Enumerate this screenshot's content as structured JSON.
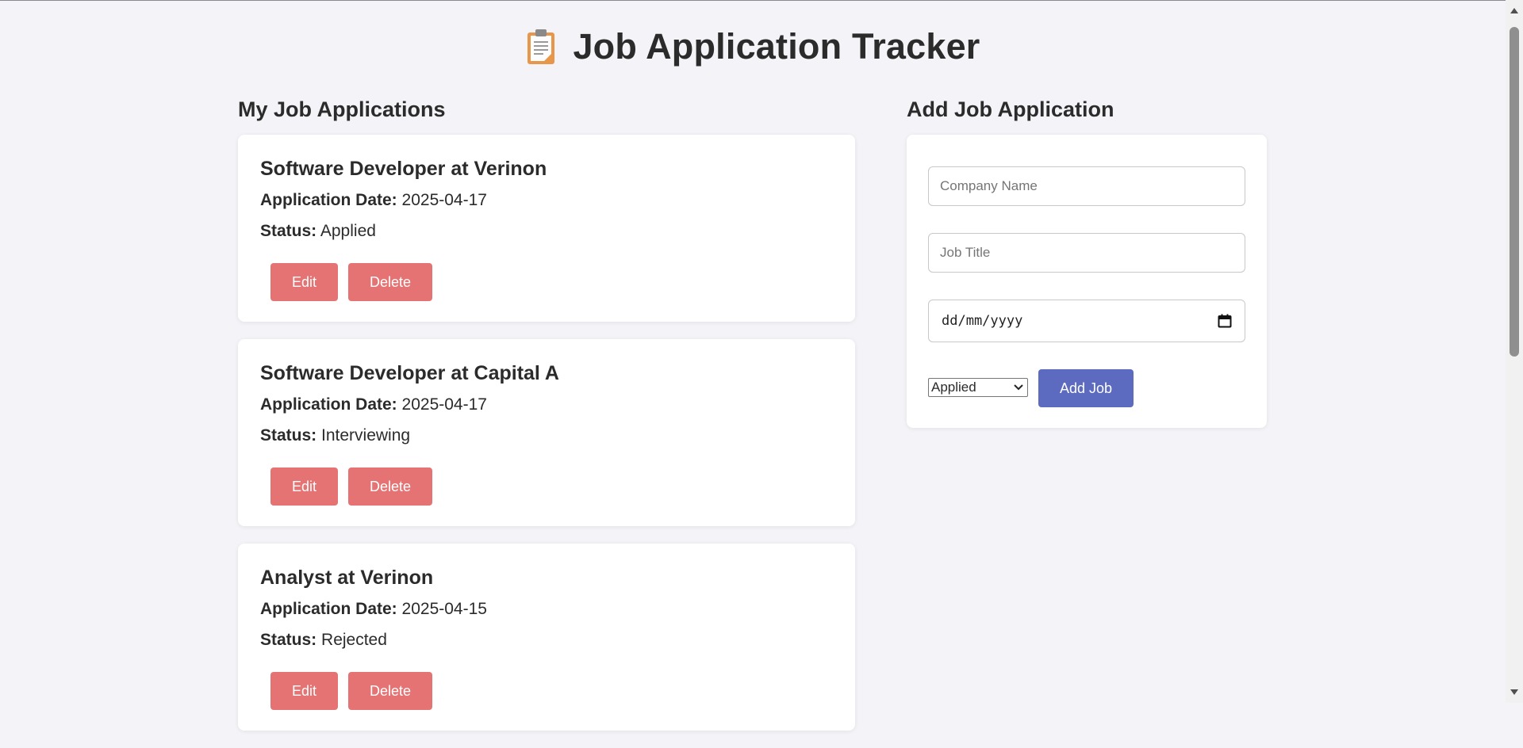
{
  "header": {
    "title": "Job Application Tracker",
    "icon": "clipboard-icon"
  },
  "list": {
    "heading": "My Job Applications",
    "date_label": "Application Date:",
    "status_label": "Status:",
    "edit_label": "Edit",
    "delete_label": "Delete",
    "jobs": [
      {
        "title": "Software Developer at Verinon",
        "date": "2025-04-17",
        "status": "Applied"
      },
      {
        "title": "Software Developer at Capital A",
        "date": "2025-04-17",
        "status": "Interviewing"
      },
      {
        "title": "Analyst at Verinon",
        "date": "2025-04-15",
        "status": "Rejected"
      }
    ]
  },
  "form": {
    "heading": "Add Job Application",
    "company_placeholder": "Company Name",
    "title_placeholder": "Job Title",
    "date_placeholder": "dd/mm/yyyy",
    "status_value": "Applied",
    "submit_label": "Add Job"
  },
  "colors": {
    "background": "#f4f4f8",
    "danger_button": "#e57373",
    "primary_button": "#5c6bc0",
    "text": "#2b2b2b"
  }
}
